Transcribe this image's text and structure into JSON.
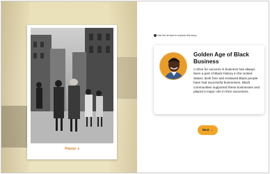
{
  "hint": {
    "icon": "info-icon",
    "text": "Use the arrows to explore this story."
  },
  "slideshow": {
    "pause_label": "Pause",
    "pause_icon": "pause-icon"
  },
  "card": {
    "avatar_icon": "narrator-avatar",
    "title": "Golden Age of Black Business",
    "body": "A drive for success in business has always been a part of Black history in the United States. Both free and enslaved Black people have had successful businesses. Black communities supported these businesses and played a major role in their successes."
  },
  "navigation": {
    "next_label": "Next",
    "next_icon": "arrow-right-icon"
  },
  "colors": {
    "accent": "#f0a52b",
    "pause_text": "#d9822b",
    "sepia_background": "#ece3bf"
  }
}
